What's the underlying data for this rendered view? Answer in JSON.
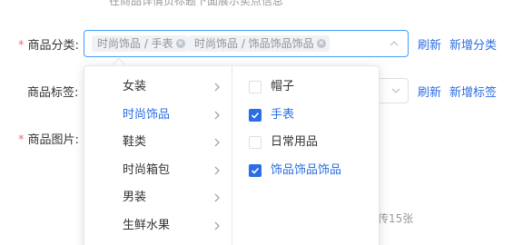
{
  "hint": "在商品详情页标题下面展示卖点信息",
  "category_field": {
    "required_mark": "*",
    "label": "商品分类:",
    "tags": [
      {
        "label": "时尚饰品 / 手表"
      },
      {
        "label": "时尚饰品 / 饰品饰品饰品"
      }
    ],
    "refresh_label": "刷新",
    "add_label": "新增分类"
  },
  "tag_field": {
    "label": "商品标签:",
    "refresh_label": "刷新",
    "add_label": "新增标签"
  },
  "image_field": {
    "required_mark": "*",
    "label": "商品图片:",
    "note": "传15张"
  },
  "cascader": {
    "level1": [
      {
        "label": "女装",
        "active": false
      },
      {
        "label": "时尚饰品",
        "active": true
      },
      {
        "label": "鞋类",
        "active": false
      },
      {
        "label": "时尚箱包",
        "active": false
      },
      {
        "label": "男装",
        "active": false
      },
      {
        "label": "生鲜水果",
        "active": false
      }
    ],
    "level2": [
      {
        "label": "帽子",
        "checked": false
      },
      {
        "label": "手表",
        "checked": true
      },
      {
        "label": "日常用品",
        "checked": false
      },
      {
        "label": "饰品饰品饰品",
        "checked": true
      }
    ]
  },
  "colors": {
    "accent": "#2b6de3",
    "required": "#f56c6c",
    "border_focus": "#409eff"
  }
}
